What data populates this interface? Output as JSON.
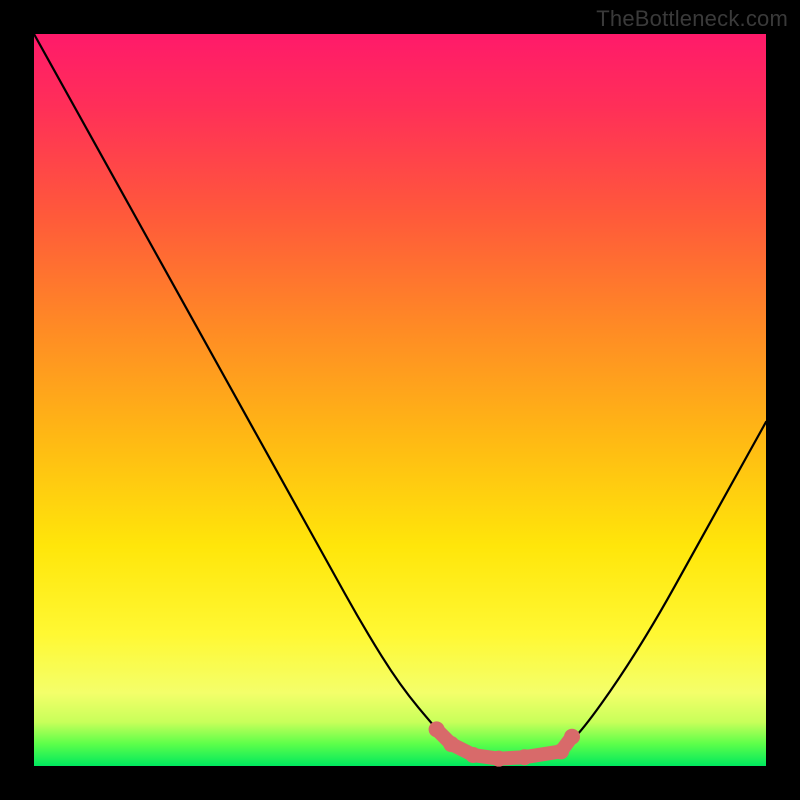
{
  "watermark": "TheBottleneck.com",
  "colors": {
    "frame": "#000000",
    "curve": "#000000",
    "marker": "#d86a6a",
    "gradient_top": "#ff1a6a",
    "gradient_bottom": "#00e85e"
  },
  "chart_data": {
    "type": "line",
    "title": "",
    "xlabel": "",
    "ylabel": "",
    "xlim": [
      0,
      100
    ],
    "ylim": [
      0,
      100
    ],
    "x": [
      0,
      5,
      10,
      15,
      20,
      25,
      30,
      35,
      40,
      45,
      50,
      55,
      57,
      60,
      63,
      66,
      69,
      72,
      75,
      80,
      85,
      90,
      95,
      100
    ],
    "values": [
      100,
      91,
      82,
      73,
      64,
      55,
      46,
      37,
      28,
      19,
      11,
      5,
      3,
      1.5,
      1,
      1,
      1.2,
      2,
      5,
      12,
      20,
      29,
      38,
      47
    ],
    "series": [
      {
        "name": "bottleneck-curve",
        "x": [
          0,
          5,
          10,
          15,
          20,
          25,
          30,
          35,
          40,
          45,
          50,
          55,
          57,
          60,
          63,
          66,
          69,
          72,
          75,
          80,
          85,
          90,
          95,
          100
        ],
        "y": [
          100,
          91,
          82,
          73,
          64,
          55,
          46,
          37,
          28,
          19,
          11,
          5,
          3,
          1.5,
          1,
          1,
          1.2,
          2,
          5,
          12,
          20,
          29,
          38,
          47
        ]
      }
    ],
    "markers": [
      {
        "name": "valley-left",
        "x": 55,
        "y": 5
      },
      {
        "name": "valley-left-2",
        "x": 57,
        "y": 3
      },
      {
        "name": "valley-bottom",
        "x": 60,
        "y": 1.5
      },
      {
        "name": "valley-min",
        "x": 63.5,
        "y": 1
      },
      {
        "name": "valley-right",
        "x": 67,
        "y": 1.2
      },
      {
        "name": "valley-up",
        "x": 72,
        "y": 2
      },
      {
        "name": "valley-up-2",
        "x": 73.5,
        "y": 4
      }
    ]
  }
}
